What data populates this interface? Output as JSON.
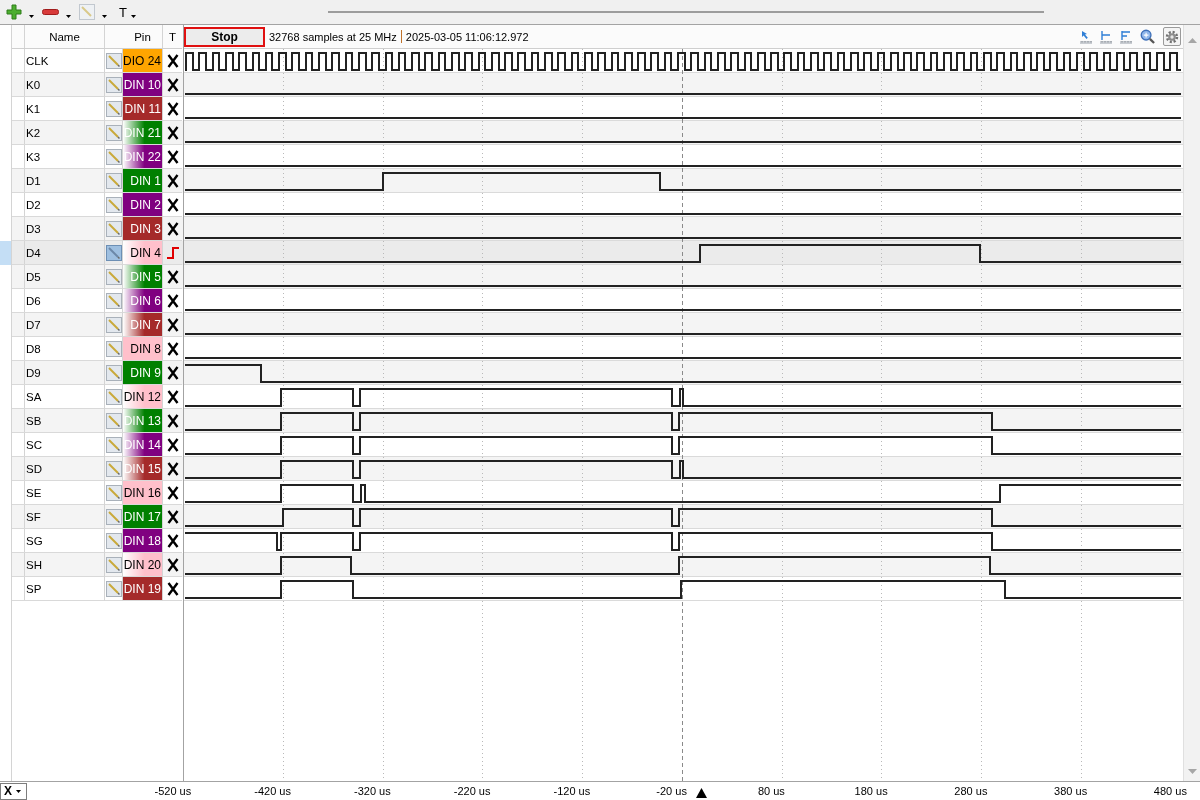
{
  "toolbar": {
    "text_tool": "T"
  },
  "columns": [
    "Name",
    "Pin",
    "T"
  ],
  "capture": {
    "stop_button": "Stop",
    "info": "32768 samples at 25 MHz",
    "timestamp": "2025-03-05 11:06:12.972"
  },
  "signals": [
    {
      "name": "CLK",
      "pin": "DIO 24",
      "color": "#ffa500",
      "gradient": false,
      "trigger": {
        "kind": "ignore"
      },
      "selected": false
    },
    {
      "name": "K0",
      "pin": "DIN 10",
      "color": "#800080",
      "gradient": false,
      "trigger": {
        "kind": "ignore"
      },
      "selected": false
    },
    {
      "name": "K1",
      "pin": "DIN 11",
      "color": "#a52a2a",
      "gradient": false,
      "trigger": {
        "kind": "ignore"
      },
      "selected": false
    },
    {
      "name": "K2",
      "pin": "DIN 21",
      "color": "#008000",
      "gradient": true,
      "trigger": {
        "kind": "ignore"
      },
      "selected": false
    },
    {
      "name": "K3",
      "pin": "DIN 22",
      "color": "#800080",
      "gradient": true,
      "trigger": {
        "kind": "ignore"
      },
      "selected": false
    },
    {
      "name": "D1",
      "pin": "DIN 1",
      "color": "#008000",
      "gradient": false,
      "trigger": {
        "kind": "ignore"
      },
      "selected": false
    },
    {
      "name": "D2",
      "pin": "DIN 2",
      "color": "#800080",
      "gradient": false,
      "trigger": {
        "kind": "ignore"
      },
      "selected": false
    },
    {
      "name": "D3",
      "pin": "DIN 3",
      "color": "#a52a2a",
      "gradient": false,
      "trigger": {
        "kind": "ignore"
      },
      "selected": false
    },
    {
      "name": "D4",
      "pin": "DIN 4",
      "color": "#ffc0cb",
      "gradient": true,
      "trigger": {
        "kind": "rising"
      },
      "selected": true
    },
    {
      "name": "D5",
      "pin": "DIN 5",
      "color": "#008000",
      "gradient": true,
      "trigger": {
        "kind": "ignore"
      },
      "selected": false
    },
    {
      "name": "D6",
      "pin": "DIN 6",
      "color": "#800080",
      "gradient": true,
      "trigger": {
        "kind": "ignore"
      },
      "selected": false
    },
    {
      "name": "D7",
      "pin": "DIN 7",
      "color": "#a52a2a",
      "gradient": true,
      "trigger": {
        "kind": "ignore"
      },
      "selected": false
    },
    {
      "name": "D8",
      "pin": "DIN 8",
      "color": "#ffc0cb",
      "gradient": false,
      "trigger": {
        "kind": "ignore"
      },
      "selected": false
    },
    {
      "name": "D9",
      "pin": "DIN 9",
      "color": "#008000",
      "gradient": false,
      "trigger": {
        "kind": "ignore"
      },
      "selected": false
    },
    {
      "name": "SA",
      "pin": "DIN 12",
      "color": "#ffc0cb",
      "gradient": true,
      "trigger": {
        "kind": "ignore"
      },
      "selected": false
    },
    {
      "name": "SB",
      "pin": "DIN 13",
      "color": "#008000",
      "gradient": true,
      "trigger": {
        "kind": "ignore"
      },
      "selected": false
    },
    {
      "name": "SC",
      "pin": "DIN 14",
      "color": "#800080",
      "gradient": true,
      "trigger": {
        "kind": "ignore"
      },
      "selected": false
    },
    {
      "name": "SD",
      "pin": "DIN 15",
      "color": "#a52a2a",
      "gradient": true,
      "trigger": {
        "kind": "ignore"
      },
      "selected": false
    },
    {
      "name": "SE",
      "pin": "DIN 16",
      "color": "#ffc0cb",
      "gradient": false,
      "trigger": {
        "kind": "ignore"
      },
      "selected": false
    },
    {
      "name": "SF",
      "pin": "DIN 17",
      "color": "#008000",
      "gradient": false,
      "trigger": {
        "kind": "ignore"
      },
      "selected": false
    },
    {
      "name": "SG",
      "pin": "DIN 18",
      "color": "#800080",
      "gradient": false,
      "trigger": {
        "kind": "ignore"
      },
      "selected": false
    },
    {
      "name": "SH",
      "pin": "DIN 20",
      "color": "#ffc0cb",
      "gradient": true,
      "trigger": {
        "kind": "ignore"
      },
      "selected": false
    },
    {
      "name": "SP",
      "pin": "DIN 19",
      "color": "#a52a2a",
      "gradient": false,
      "trigger": {
        "kind": "ignore"
      },
      "selected": false
    }
  ],
  "time_axis": {
    "selector": "X",
    "labels": [
      "-520 us",
      "-420 us",
      "-320 us",
      "-220 us",
      "-120 us",
      "-20 us",
      "80 us",
      "180 us",
      "280 us",
      "380 us",
      "480 us"
    ]
  }
}
